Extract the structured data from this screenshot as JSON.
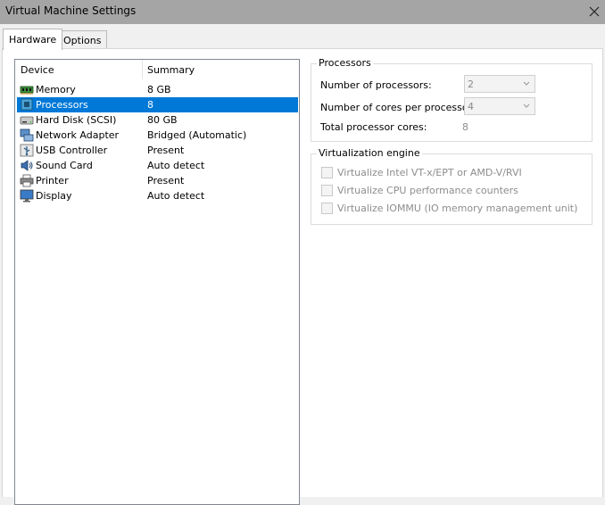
{
  "window": {
    "title": "Virtual Machine Settings"
  },
  "tabs": [
    {
      "label": "Hardware",
      "active": true
    },
    {
      "label": "Options",
      "active": false
    }
  ],
  "devices": {
    "columns": {
      "device": "Device",
      "summary": "Summary"
    },
    "items": [
      {
        "name": "Memory",
        "summary": "8 GB",
        "icon": "memory-icon"
      },
      {
        "name": "Processors",
        "summary": "8",
        "icon": "processor-icon",
        "selected": true
      },
      {
        "name": "Hard Disk (SCSI)",
        "summary": "80 GB",
        "icon": "hard-disk-icon"
      },
      {
        "name": "Network Adapter",
        "summary": "Bridged (Automatic)",
        "icon": "network-adapter-icon"
      },
      {
        "name": "USB Controller",
        "summary": "Present",
        "icon": "usb-icon"
      },
      {
        "name": "Sound Card",
        "summary": "Auto detect",
        "icon": "sound-card-icon"
      },
      {
        "name": "Printer",
        "summary": "Present",
        "icon": "printer-icon"
      },
      {
        "name": "Display",
        "summary": "Auto detect",
        "icon": "display-icon"
      }
    ]
  },
  "processors": {
    "group_title": "Processors",
    "num_processors_label": "Number of processors:",
    "num_processors_value": "2",
    "cores_label": "Number of cores per processor:",
    "cores_value": "4",
    "total_label": "Total processor cores:",
    "total_value": "8"
  },
  "virtualization": {
    "group_title": "Virtualization engine",
    "options": [
      {
        "label": "Virtualize Intel VT-x/EPT or AMD-V/RVI",
        "checked": false
      },
      {
        "label": "Virtualize CPU performance counters",
        "checked": false
      },
      {
        "label": "Virtualize IOMMU (IO memory management unit)",
        "checked": false
      }
    ]
  },
  "colors": {
    "selection": "#0078d7",
    "titlebar": "#a5a5a5",
    "disabled_text": "#8d8d8d"
  }
}
